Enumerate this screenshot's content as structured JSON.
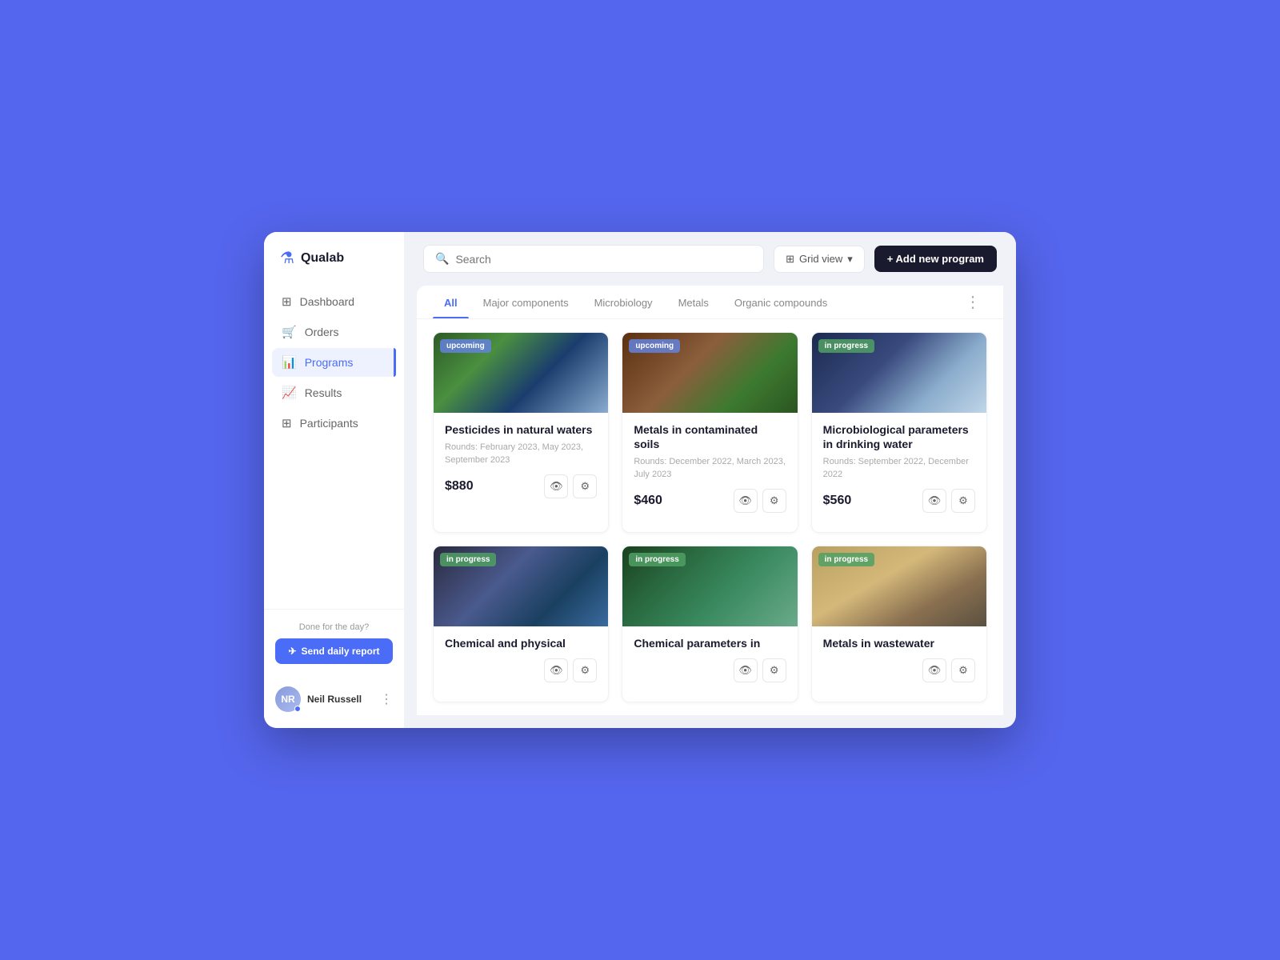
{
  "app": {
    "logo_text": "Qualab"
  },
  "sidebar": {
    "nav_items": [
      {
        "id": "dashboard",
        "label": "Dashboard",
        "icon": "⊞"
      },
      {
        "id": "orders",
        "label": "Orders",
        "icon": "🛒"
      },
      {
        "id": "programs",
        "label": "Programs",
        "icon": "📊",
        "active": true
      },
      {
        "id": "results",
        "label": "Results",
        "icon": "📈"
      },
      {
        "id": "participants",
        "label": "Participants",
        "icon": "⊞"
      }
    ],
    "done_text": "Done for the day?",
    "send_report_label": "Send daily report",
    "user": {
      "name": "Neil Russell",
      "initials": "NR"
    }
  },
  "header": {
    "search_placeholder": "Search",
    "grid_view_label": "Grid view",
    "add_program_label": "+ Add new program"
  },
  "tabs": [
    {
      "id": "all",
      "label": "All",
      "active": true
    },
    {
      "id": "major",
      "label": "Major components"
    },
    {
      "id": "microbiology",
      "label": "Microbiology"
    },
    {
      "id": "metals",
      "label": "Metals"
    },
    {
      "id": "organic",
      "label": "Organic compounds"
    }
  ],
  "cards": [
    {
      "id": "card1",
      "badge": "upcoming",
      "badge_type": "upcoming",
      "title": "Pesticides in natural waters",
      "rounds": "Rounds: February 2023, May 2023, September 2023",
      "price": "$880",
      "img_class": "img-waters"
    },
    {
      "id": "card2",
      "badge": "upcoming",
      "badge_type": "upcoming",
      "title": "Metals in contaminated soils",
      "rounds": "Rounds: December 2022, March 2023, July 2023",
      "price": "$460",
      "img_class": "img-soils"
    },
    {
      "id": "card3",
      "badge": "in progress",
      "badge_type": "inprogress",
      "title": "Microbiological parameters in drinking water",
      "rounds": "Rounds: September 2022, December 2022",
      "price": "$560",
      "img_class": "img-microb"
    },
    {
      "id": "card4",
      "badge": "in progress",
      "badge_type": "inprogress",
      "title": "Chemical and physical",
      "rounds": "",
      "price": "",
      "img_class": "img-chemical"
    },
    {
      "id": "card5",
      "badge": "in progress",
      "badge_type": "inprogress",
      "title": "Chemical parameters in",
      "rounds": "",
      "price": "",
      "img_class": "img-chem-params"
    },
    {
      "id": "card6",
      "badge": "in progress",
      "badge_type": "inprogress",
      "title": "Metals in wastewater",
      "rounds": "",
      "price": "",
      "img_class": "img-metals-ww"
    }
  ]
}
